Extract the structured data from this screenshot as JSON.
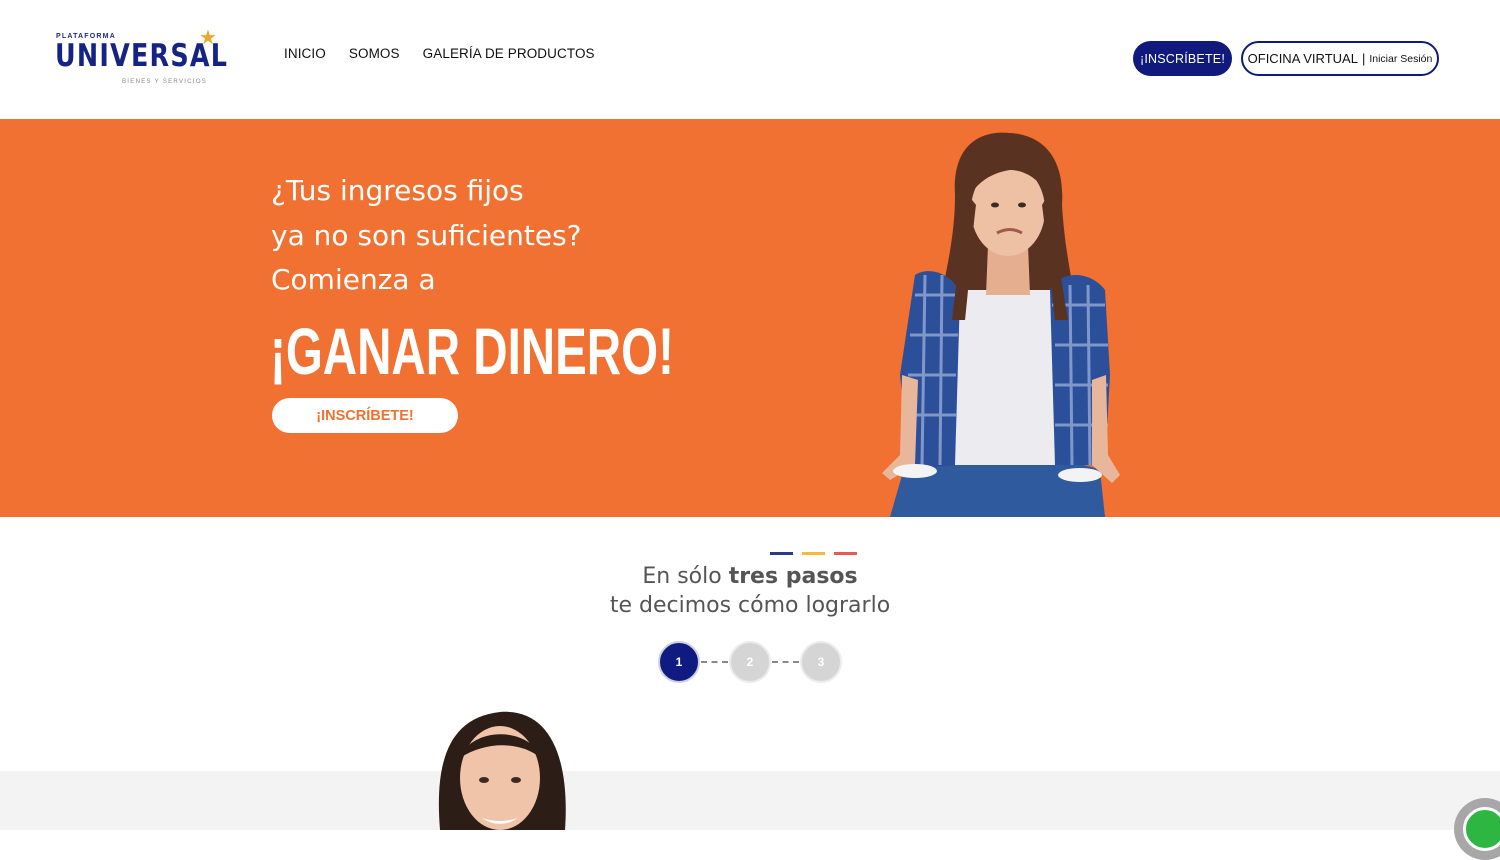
{
  "brand": {
    "top": "PLATAFORMA",
    "name": "UNIVERSAL",
    "tagline": "BIENES Y SERVICIOS"
  },
  "nav": {
    "items": [
      "INICIO",
      "SOMOS",
      "GALERÍA DE PRODUCTOS"
    ]
  },
  "header_actions": {
    "signup": "¡INSCRÍBETE!",
    "office": "OFICINA VIRTUAL",
    "separator": "|",
    "login": "Iniciar Sesión"
  },
  "hero": {
    "line1": "¿Tus ingresos fijos",
    "line2": "ya no son suficientes?",
    "line3": "Comienza a",
    "headline": "¡GANAR DINERO!",
    "cta": "¡INSCRÍBETE!"
  },
  "steps": {
    "title_pre": "En sólo ",
    "title_bold": "tres pasos",
    "subtitle": "te decimos cómo lograrlo",
    "items": [
      "1",
      "2",
      "3"
    ],
    "active": 1
  },
  "colors": {
    "brand_blue": "#101a7c",
    "hero_orange": "#f07131",
    "accent_yellow": "#f5b942",
    "accent_red": "#e85a4f",
    "whatsapp_green": "#2db742"
  },
  "icons": [
    "star-icon",
    "whatsapp-icon"
  ]
}
